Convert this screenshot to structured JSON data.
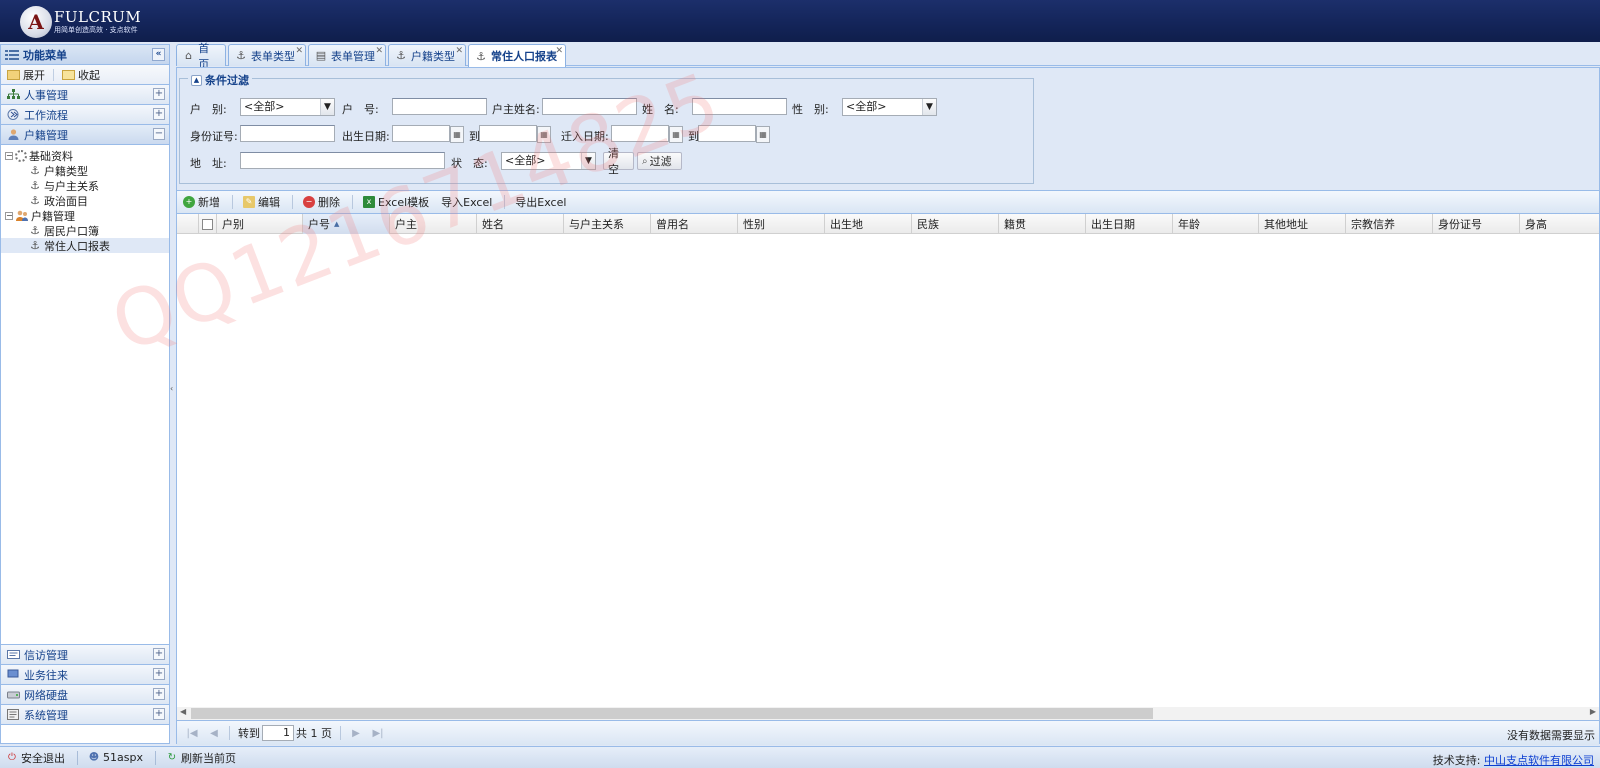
{
  "header": {
    "logo_letter": "A",
    "title": "FULCRUM",
    "subtitle": "用简单创造高效 · 支点软件"
  },
  "sidebar": {
    "title": "功能菜单",
    "collapse_glyph": "«",
    "expand_label": "展开",
    "collapse_label": "收起",
    "top_sections": [
      {
        "label": "人事管理",
        "toggle": "+"
      },
      {
        "label": "工作流程",
        "toggle": "+"
      },
      {
        "label": "户籍管理",
        "toggle": "−"
      }
    ],
    "tree": {
      "group1": {
        "label": "基础资料",
        "toggle": "⊟"
      },
      "group1_items": [
        "户籍类型",
        "与户主关系",
        "政治面目"
      ],
      "group2": {
        "label": "户籍管理",
        "toggle": "⊟"
      },
      "group2_items": [
        "居民户口簿",
        "常住人口报表"
      ]
    },
    "bottom_sections": [
      {
        "label": "信访管理",
        "toggle": "+"
      },
      {
        "label": "业务往来",
        "toggle": "+"
      },
      {
        "label": "网络硬盘",
        "toggle": "+"
      },
      {
        "label": "系统管理",
        "toggle": "+"
      }
    ]
  },
  "tabs": [
    {
      "label": "首页"
    },
    {
      "label": "表单类型"
    },
    {
      "label": "表单管理"
    },
    {
      "label": "户籍类型"
    },
    {
      "label": "常住人口报表"
    }
  ],
  "filter": {
    "legend": "条件过滤",
    "household_type_label": "户　别:",
    "household_type_value": "<全部>",
    "household_no_label": "户　号:",
    "head_name_label": "户主姓名:",
    "name_label": "姓　名:",
    "gender_label": "性　别:",
    "gender_value": "<全部>",
    "id_label": "身份证号:",
    "birth_label": "出生日期:",
    "to_label": "到",
    "movein_label": "迁入日期:",
    "address_label": "地　址:",
    "status_label": "状　态:",
    "status_value": "<全部>",
    "clear_button": "清空",
    "filter_button": "过滤"
  },
  "toolbar": {
    "new": "新增",
    "edit": "编辑",
    "delete": "删除",
    "excel_template": "Excel模板",
    "import_excel": "导入Excel",
    "export_excel": "导出Excel"
  },
  "grid": {
    "columns": [
      "户别",
      "户号",
      "户主",
      "姓名",
      "与户主关系",
      "曾用名",
      "性别",
      "出生地",
      "民族",
      "籍贯",
      "出生日期",
      "年龄",
      "其他地址",
      "宗教信养",
      "身份证号",
      "身高"
    ],
    "sort_indicator": "▲"
  },
  "pager": {
    "goto_label": "转到",
    "page_value": "1",
    "total_label": "共 1 页",
    "empty_message": "没有数据需要显示"
  },
  "footer": {
    "logout": "安全退出",
    "user": "51aspx",
    "refresh": "刷新当前页",
    "support_label": "技术支持:",
    "support_link": "中山支点软件有限公司"
  },
  "watermark": "QQ1216714825",
  "colors": {
    "header": "#14255a",
    "panel_border": "#99bbe8",
    "title_text": "#15428b",
    "link": "#0c3ed1"
  }
}
